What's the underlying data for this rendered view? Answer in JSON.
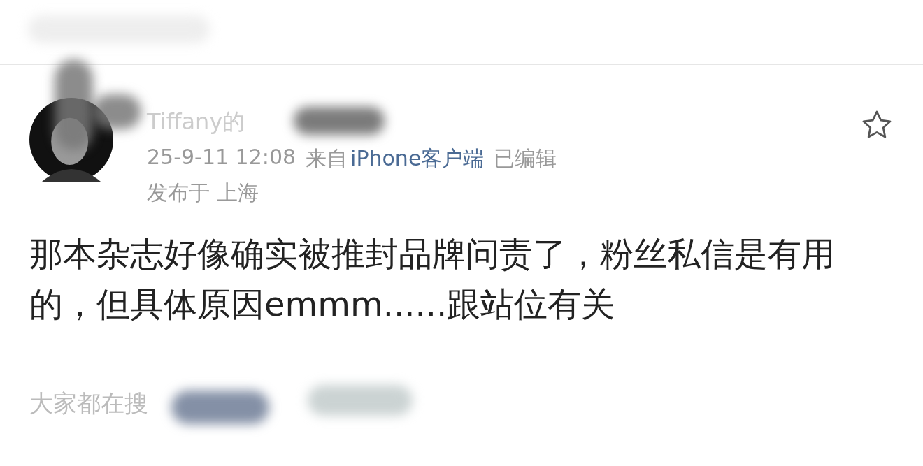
{
  "comment": {
    "username": "Tiffany的",
    "starred": false,
    "time": "25-9-11 12:08",
    "source_prefix": "来自",
    "source": "iPhone客户端",
    "edited": "已编辑",
    "location": "发布于 上海",
    "text": "那本杂志好像确实被推封品牌问责了，粉丝私信是有用的，但具体原因emmm......跟站位有关"
  },
  "trending": {
    "label": "大家都在搜"
  }
}
